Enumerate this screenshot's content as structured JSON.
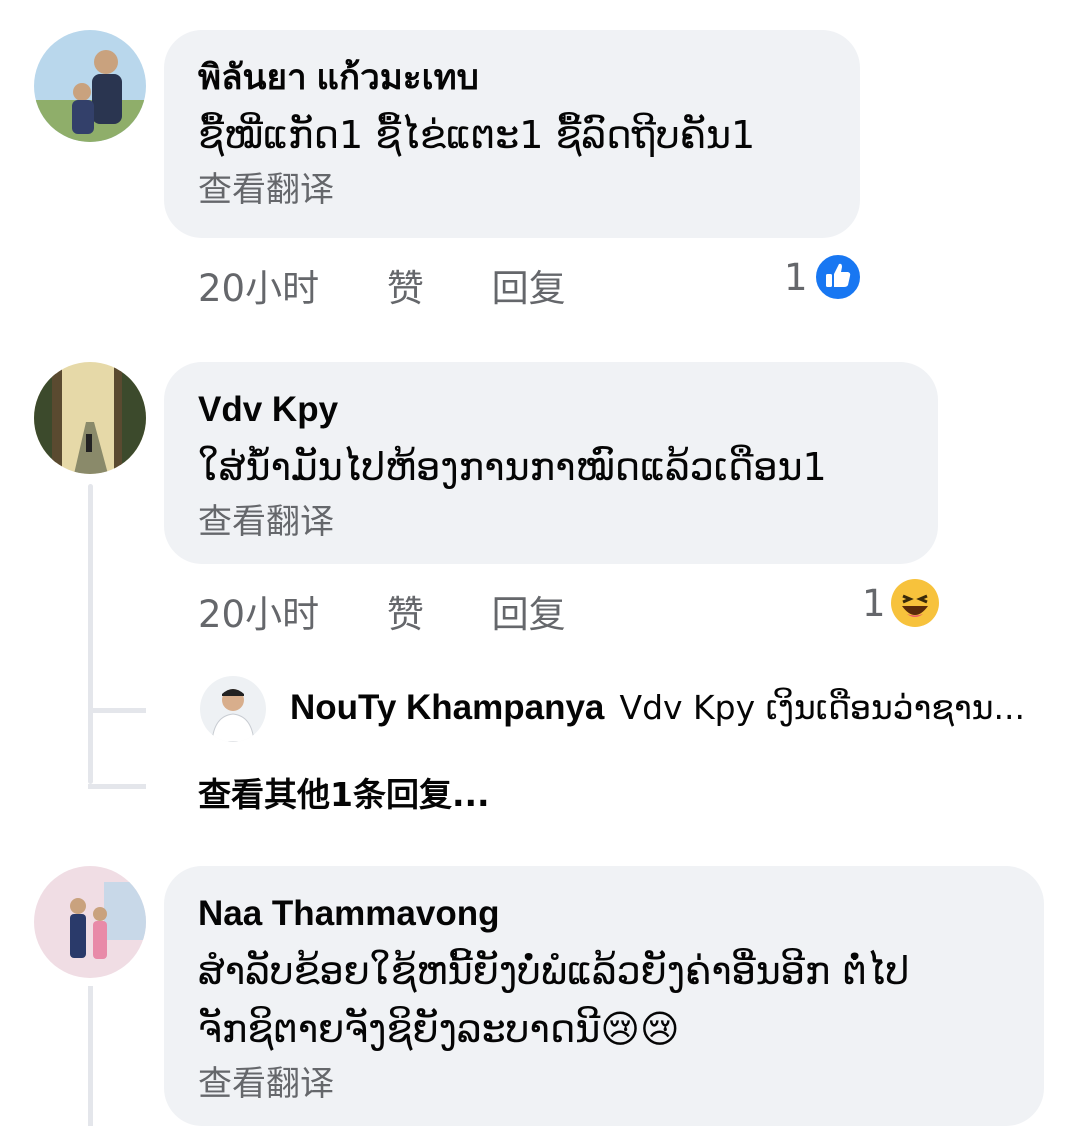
{
  "comments": [
    {
      "author": "พิลันยา แก้วมะเทบ",
      "text": "ຊື້ໝີ່ແກັດ1 ຊື້ໄຂ່ແຕະ1 ຊື້ລົດຖີບຄັນ1",
      "translate": "查看翻译",
      "time": "20小时",
      "like": "赞",
      "reply": "回复",
      "reaction_count": "1",
      "reaction": "like-icon"
    },
    {
      "author": "Vdv Kpy",
      "text": "ໃສ່ນ້ຳມັນໄປຫ້ອງການກາໝົດແລ້ວເດືອນ1",
      "translate": "查看翻译",
      "time": "20小时",
      "like": "赞",
      "reply": "回复",
      "reaction_count": "1",
      "reaction": "haha-icon"
    },
    {
      "author": "Naa Thammavong",
      "text_line1": "ສໍາລັບຂ້ອຍໃຊ້ຫນີ້ຍັງບໍ່ພໍແລ້ວຍັງຄ່າອື່ນອີກ ຕໍ່ໄປ",
      "text_line2": "ຈັກຊິຕາຍຈັງຊິຍັງລະບາດນີ",
      "text_emoji": "😢😢",
      "translate": "查看翻译"
    }
  ],
  "reply_preview": {
    "author": "NouTy Khampanya",
    "text": "Vdv Kpy ເງິນເດືອນວ່າຊານ..."
  },
  "view_more_replies": "查看其他1条回复...",
  "colors": {
    "bubble": "#f0f2f5",
    "meta": "#65676b",
    "like_blue": "#1877f2",
    "haha_yellow": "#f7c23c"
  }
}
